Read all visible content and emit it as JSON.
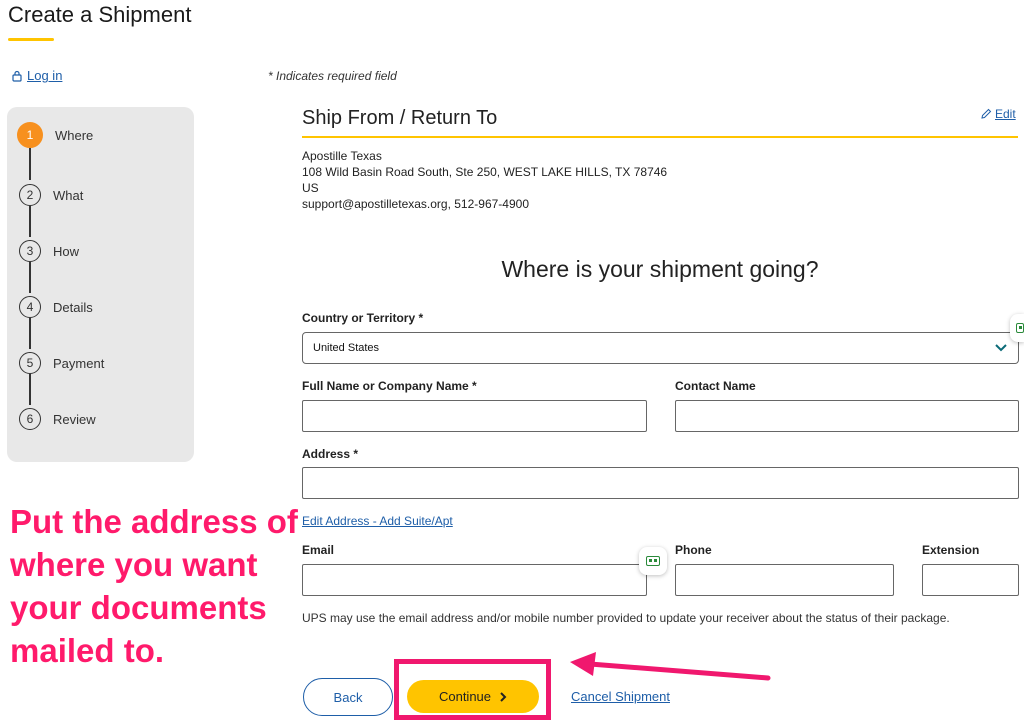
{
  "header": {
    "title": "Create a Shipment"
  },
  "login": {
    "label": "Log in"
  },
  "required_note": "* Indicates required field",
  "steps": [
    {
      "num": "1",
      "label": "Where"
    },
    {
      "num": "2",
      "label": "What"
    },
    {
      "num": "3",
      "label": "How"
    },
    {
      "num": "4",
      "label": "Details"
    },
    {
      "num": "5",
      "label": "Payment"
    },
    {
      "num": "6",
      "label": "Review"
    }
  ],
  "ship_from": {
    "title": "Ship From / Return To",
    "edit_label": "Edit",
    "lines": [
      "Apostille Texas",
      "108 Wild Basin Road South, Ste 250, WEST LAKE HILLS, TX 78746",
      "US",
      "support@apostilletexas.org, 512-967-4900"
    ]
  },
  "form": {
    "question": "Where is your shipment going?",
    "country_label": "Country or Territory *",
    "country_value": "United States",
    "full_name_label": "Full Name or Company Name *",
    "contact_name_label": "Contact Name",
    "address_label": "Address *",
    "edit_address_link": "Edit Address - Add Suite/Apt",
    "email_label": "Email",
    "phone_label": "Phone",
    "extension_label": "Extension",
    "notice": "UPS may use the email address and/or mobile number provided to update your receiver about the status of their package."
  },
  "actions": {
    "back_label": "Back",
    "continue_label": "Continue",
    "cancel_label": "Cancel Shipment"
  },
  "annotation": {
    "text": "Put the address of where you want your documents mailed to."
  },
  "colors": {
    "accent_yellow": "#ffc400",
    "step_active": "#f7901e",
    "link_blue": "#1e5ea8",
    "annotation_pink": "#f0186e"
  },
  "icons": [
    "lock-icon",
    "pencil-icon",
    "chevron-down-icon",
    "chevron-right-icon",
    "id-card-icon",
    "arrow-icon"
  ]
}
